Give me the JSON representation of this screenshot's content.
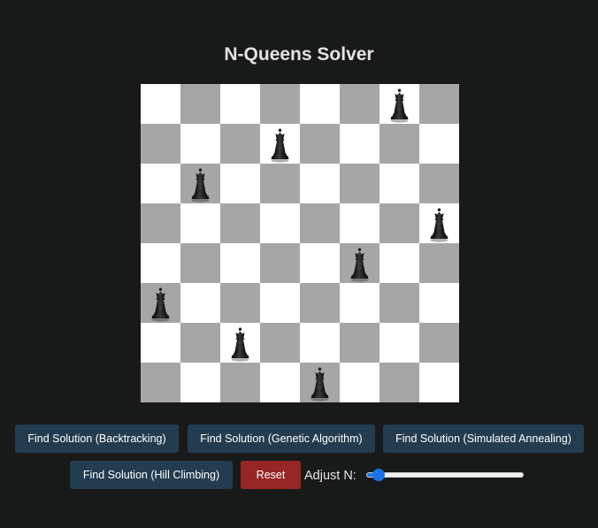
{
  "title": "N-Queens Solver",
  "board": {
    "n": 8,
    "queens": [
      6,
      3,
      1,
      7,
      5,
      0,
      2,
      4
    ],
    "colors": {
      "light": "#ffffff",
      "dark": "#a6a6a6"
    }
  },
  "buttons": {
    "backtracking": "Find Solution (Backtracking)",
    "genetic": "Find Solution (Genetic Algorithm)",
    "annealing": "Find Solution (Simulated Annealing)",
    "hill_climbing": "Find Solution (Hill Climbing)",
    "reset": "Reset"
  },
  "slider": {
    "label": "Adjust N:",
    "value_fraction": 0.04
  },
  "colors": {
    "background": "#181a1a",
    "button_blue": "#233c4f",
    "button_red": "#962525",
    "slider_accent": "#1a73e8"
  }
}
